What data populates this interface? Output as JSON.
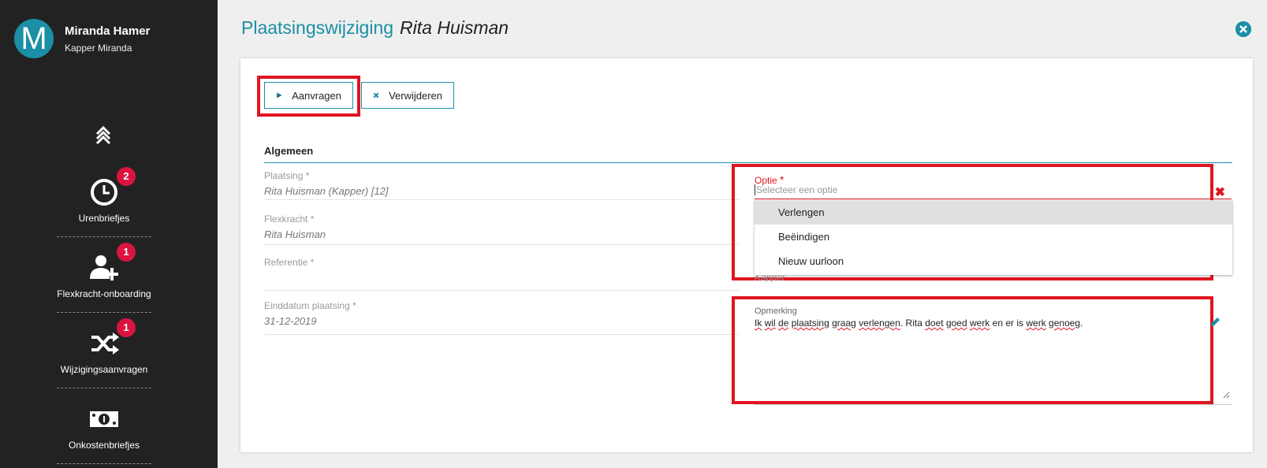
{
  "user": {
    "initial": "M",
    "name": "Miranda Hamer",
    "subtitle": "Kapper Miranda"
  },
  "nav": [
    {
      "label": "Urenbriefjes",
      "icon": "clock-icon",
      "badge": "2"
    },
    {
      "label": "Flexkracht-onboarding",
      "icon": "add-user-icon",
      "badge": "1"
    },
    {
      "label": "Wijzigingsaanvragen",
      "icon": "shuffle-icon",
      "badge": "1"
    },
    {
      "label": "Onkostenbriefjes",
      "icon": "money-icon",
      "badge": ""
    }
  ],
  "header": {
    "title": "Plaatsingswijziging",
    "person": "Rita Huisman"
  },
  "toolbar": {
    "request_label": "Aanvragen",
    "delete_label": "Verwijderen"
  },
  "section": {
    "title": "Algemeen"
  },
  "fields": [
    {
      "label": "Plaatsing",
      "required": "*",
      "value": "Rita Huisman (Kapper) [12]"
    },
    {
      "label": "Flexkracht",
      "required": "*",
      "value": "Rita Huisman"
    },
    {
      "label": "Referentie",
      "required": "*",
      "value": ""
    },
    {
      "label": "Einddatum plaatsing",
      "required": "*",
      "value": "31-12-2019"
    }
  ],
  "optie": {
    "label": "Optie",
    "required": "*",
    "placeholder": "Selecteer een optie",
    "options": [
      "Verlengen",
      "Beëindigen",
      "Nieuw uurloon"
    ],
    "hidden_value": "Kapper"
  },
  "opmerking": {
    "label": "Opmerking",
    "words": [
      "Ik",
      " ",
      "wil",
      " ",
      "de",
      " ",
      "plaatsing",
      " ",
      "graag",
      " ",
      "verlengen",
      ". Rita ",
      "doet",
      " ",
      "goed",
      " ",
      "werk",
      " en er is ",
      "werk",
      " ",
      "genoeg",
      "."
    ]
  },
  "colors": {
    "accent": "#1a8fa6",
    "sidebar": "#222222",
    "badge": "#d9143f",
    "highlight": "#e0151f"
  }
}
